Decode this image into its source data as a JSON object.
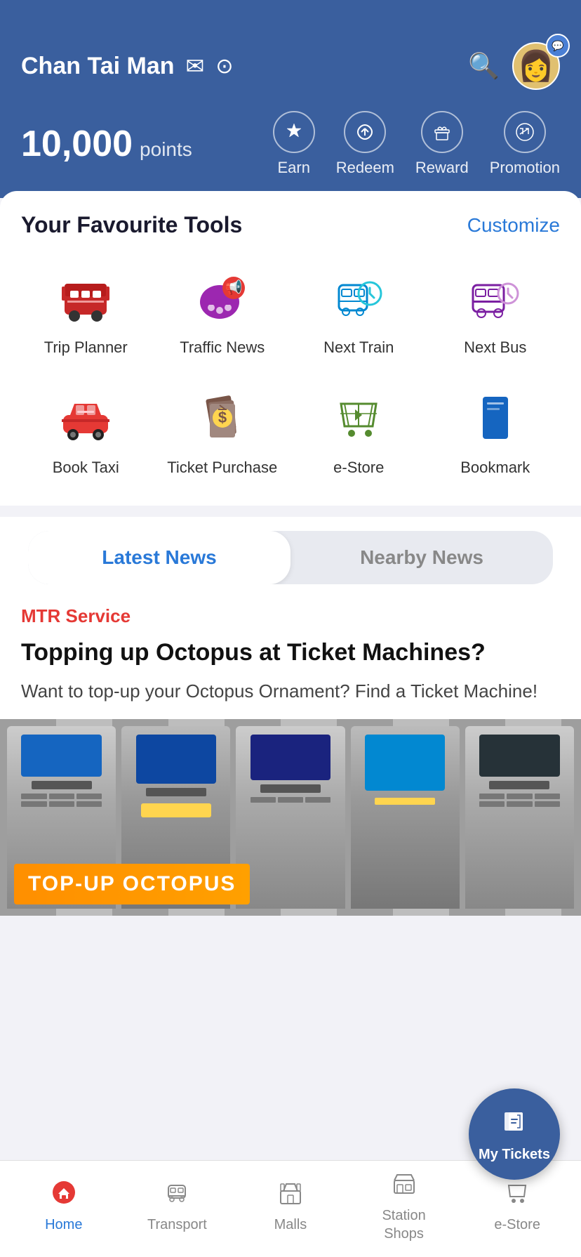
{
  "header": {
    "username": "Chan Tai Man",
    "points_number": "10,000",
    "points_label": "points",
    "actions": [
      {
        "id": "earn",
        "label": "Earn",
        "icon": "⭐"
      },
      {
        "id": "redeem",
        "label": "Redeem",
        "icon": "↺"
      },
      {
        "id": "reward",
        "label": "Reward",
        "icon": "🎁"
      },
      {
        "id": "promotion",
        "label": "Promotion",
        "icon": "📣"
      }
    ]
  },
  "fav_tools": {
    "title": "Your Favourite Tools",
    "customize_label": "Customize",
    "tools": [
      {
        "id": "trip-planner",
        "label": "Trip Planner",
        "color": "#c62828"
      },
      {
        "id": "traffic-news",
        "label": "Traffic News",
        "color": "#8e24aa",
        "has_notif": true
      },
      {
        "id": "next-train",
        "label": "Next Train",
        "color": "#0288d1"
      },
      {
        "id": "next-bus",
        "label": "Next Bus",
        "color": "#6a1b9a"
      },
      {
        "id": "book-taxi",
        "label": "Book Taxi",
        "color": "#e53935"
      },
      {
        "id": "ticket-purchase",
        "label": "Ticket Purchase",
        "color": "#795548"
      },
      {
        "id": "e-store",
        "label": "e-Store",
        "color": "#558b2f"
      },
      {
        "id": "bookmark",
        "label": "Bookmark",
        "color": "#1565c0"
      }
    ]
  },
  "news": {
    "tab_latest": "Latest News",
    "tab_nearby": "Nearby News",
    "active_tab": "latest",
    "category": "MTR Service",
    "title": "Topping up Octopus at Ticket Machines?",
    "description": "Want to top-up your Octopus Ornament? Find a Ticket Machine!",
    "image_banner": "TOP-UP OCTOPUS"
  },
  "my_tickets": {
    "label": "My Tickets"
  },
  "bottom_nav": {
    "items": [
      {
        "id": "home",
        "label": "Home",
        "active": true
      },
      {
        "id": "transport",
        "label": "Transport",
        "active": false
      },
      {
        "id": "malls",
        "label": "Malls",
        "active": false
      },
      {
        "id": "station-shops",
        "label": "Station\nShops",
        "active": false
      },
      {
        "id": "e-store",
        "label": "e-Store",
        "active": false
      }
    ]
  }
}
